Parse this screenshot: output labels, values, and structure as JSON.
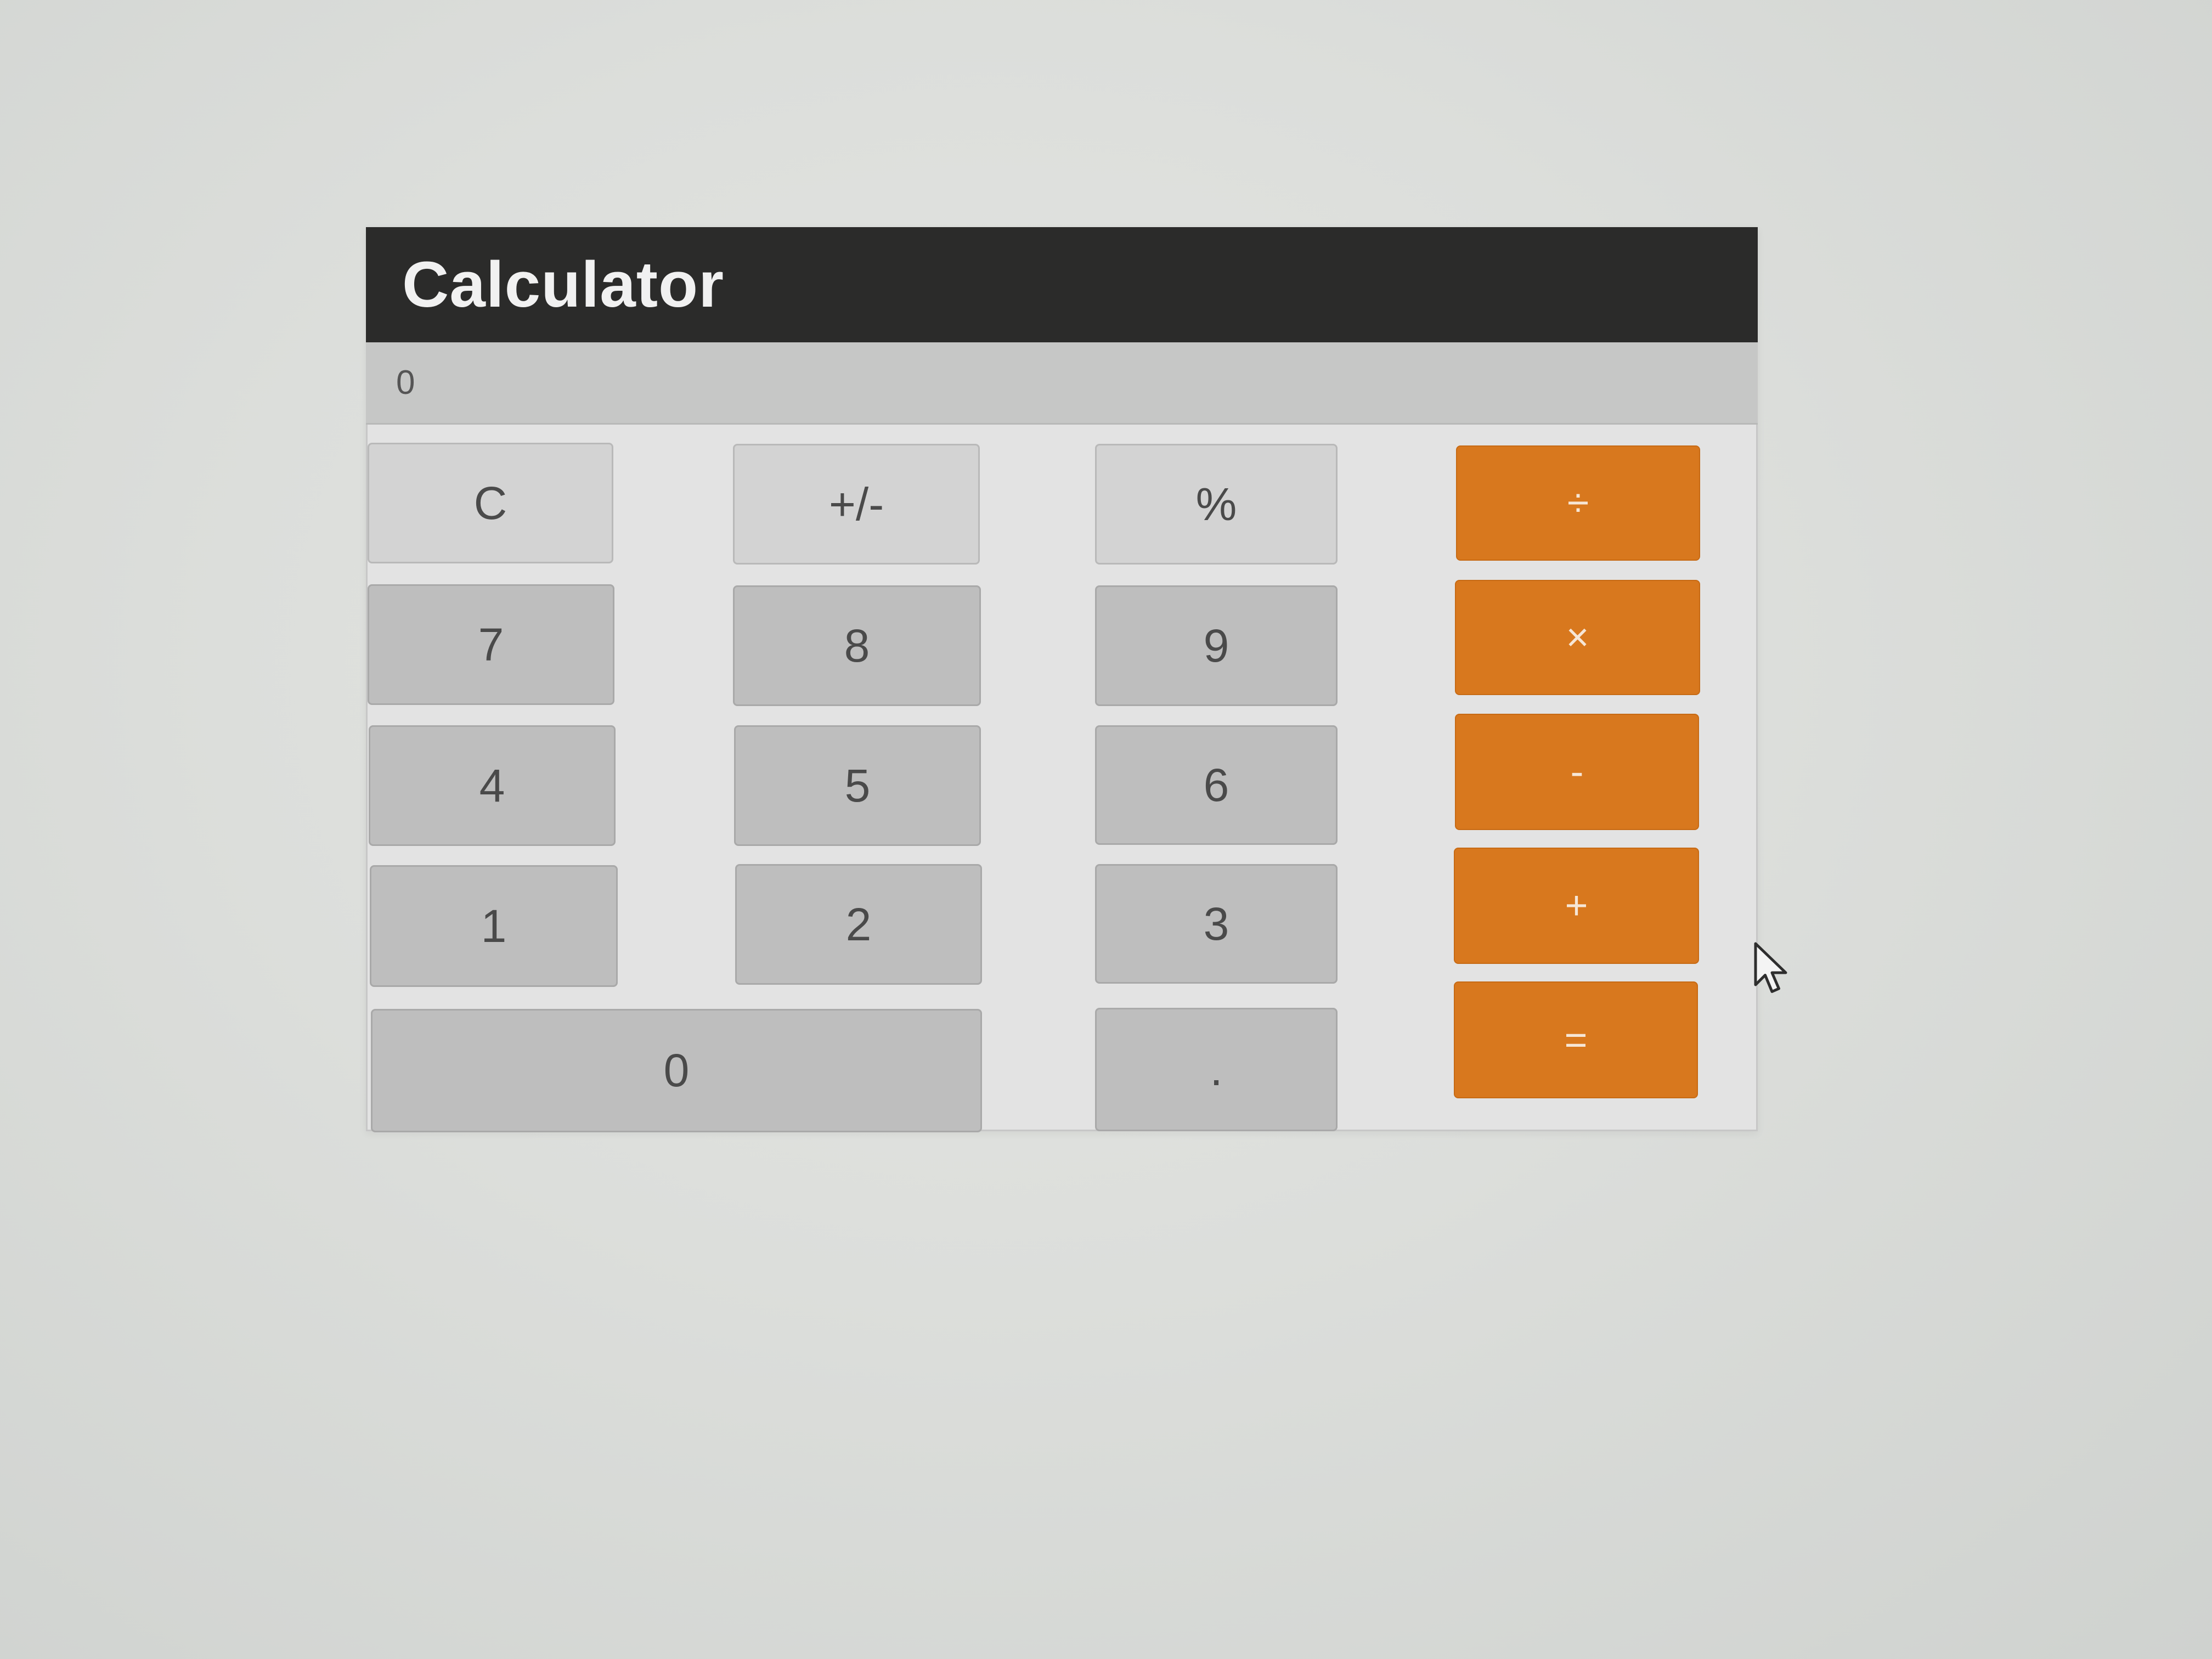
{
  "app": {
    "title": "Calculator"
  },
  "display": {
    "value": "0"
  },
  "keys": {
    "clear": "C",
    "sign": "+/-",
    "percent": "%",
    "divide": "÷",
    "seven": "7",
    "eight": "8",
    "nine": "9",
    "multiply": "×",
    "four": "4",
    "five": "5",
    "six": "6",
    "minus": "-",
    "one": "1",
    "two": "2",
    "three": "3",
    "plus": "+",
    "zero": "0",
    "decimal": ".",
    "equals": "="
  },
  "colors": {
    "title_bar": "#2b2b2a",
    "operator": "#d8781e",
    "number_key": "#bebebe",
    "function_key": "#d3d3d3"
  },
  "icons": {
    "cursor": "mouse-pointer-icon"
  }
}
